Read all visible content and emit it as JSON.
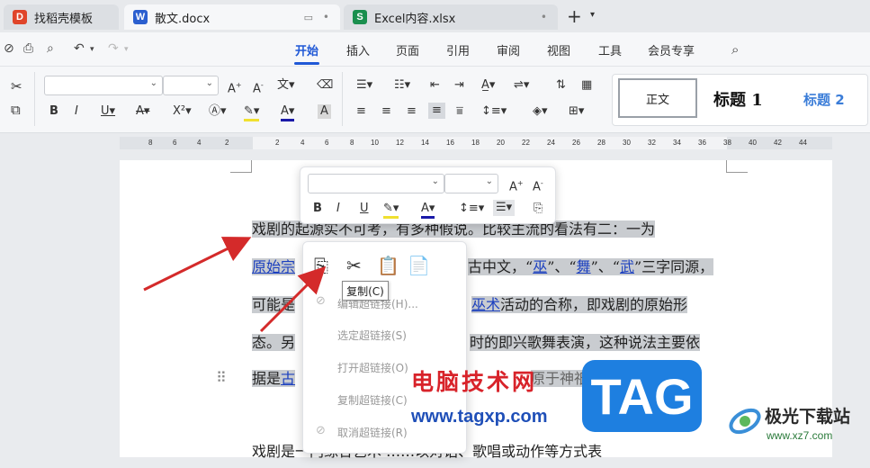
{
  "tabs": [
    {
      "label": "找稻壳模板",
      "icon": "docer-icon",
      "color": "#e0452a"
    },
    {
      "label": "散文.docx",
      "icon": "W",
      "color": "#2b5fcf"
    },
    {
      "label": "Excel内容.xlsx",
      "icon": "S",
      "color": "#1a8f4e"
    }
  ],
  "menu": [
    "开始",
    "插入",
    "页面",
    "引用",
    "审阅",
    "视图",
    "工具",
    "会员专享"
  ],
  "styles": {
    "normal": "正文",
    "h1": "标题 1",
    "h2": "标题 2"
  },
  "ruler": [
    "8",
    "6",
    "4",
    "2",
    "2",
    "4",
    "6",
    "8",
    "10",
    "12",
    "14",
    "16",
    "18",
    "20",
    "22",
    "24",
    "26",
    "28",
    "30",
    "32",
    "34",
    "36",
    "38",
    "40",
    "42",
    "44"
  ],
  "doc": {
    "line1": "戏剧的起源实不可考，有多种假说。比较主流的看法有二：一为",
    "line2_link": "原始宗",
    "line2_rest": "古中文，“",
    "l2_wu1": "巫",
    "l2_sep1": "”、“",
    "l2_wu2": "舞",
    "l2_sep2": "”、“",
    "l2_wu3": "武",
    "l2_tail": "”三字同源，",
    "line3_pre": "可能是",
    "line3_link": "巫术",
    "line3_rest": "活动的合称，即戏剧的原始形",
    "line4_pre": "态。另",
    "line4_rest": "时的即兴歌舞表演，这种说法主要依",
    "line5_pre": "据是",
    "line5_link": "古",
    "line5_rest": "原于神祇",
    "line6": "戏剧是一门综合艺术 ……以对话、歌唱或动作等方式表"
  },
  "context_menu": {
    "tooltip": "复制(C)",
    "items": [
      "编辑超链接(H)...",
      "选定超链接(S)",
      "打开超链接(O)",
      "复制超链接(C)",
      "取消超链接(R)"
    ]
  },
  "watermark": {
    "cn": "电脑技术网",
    "url": "www.tagxp.com",
    "tag": "TAG",
    "site2": "极光下载站",
    "site2_url": "www.xz7.com"
  }
}
